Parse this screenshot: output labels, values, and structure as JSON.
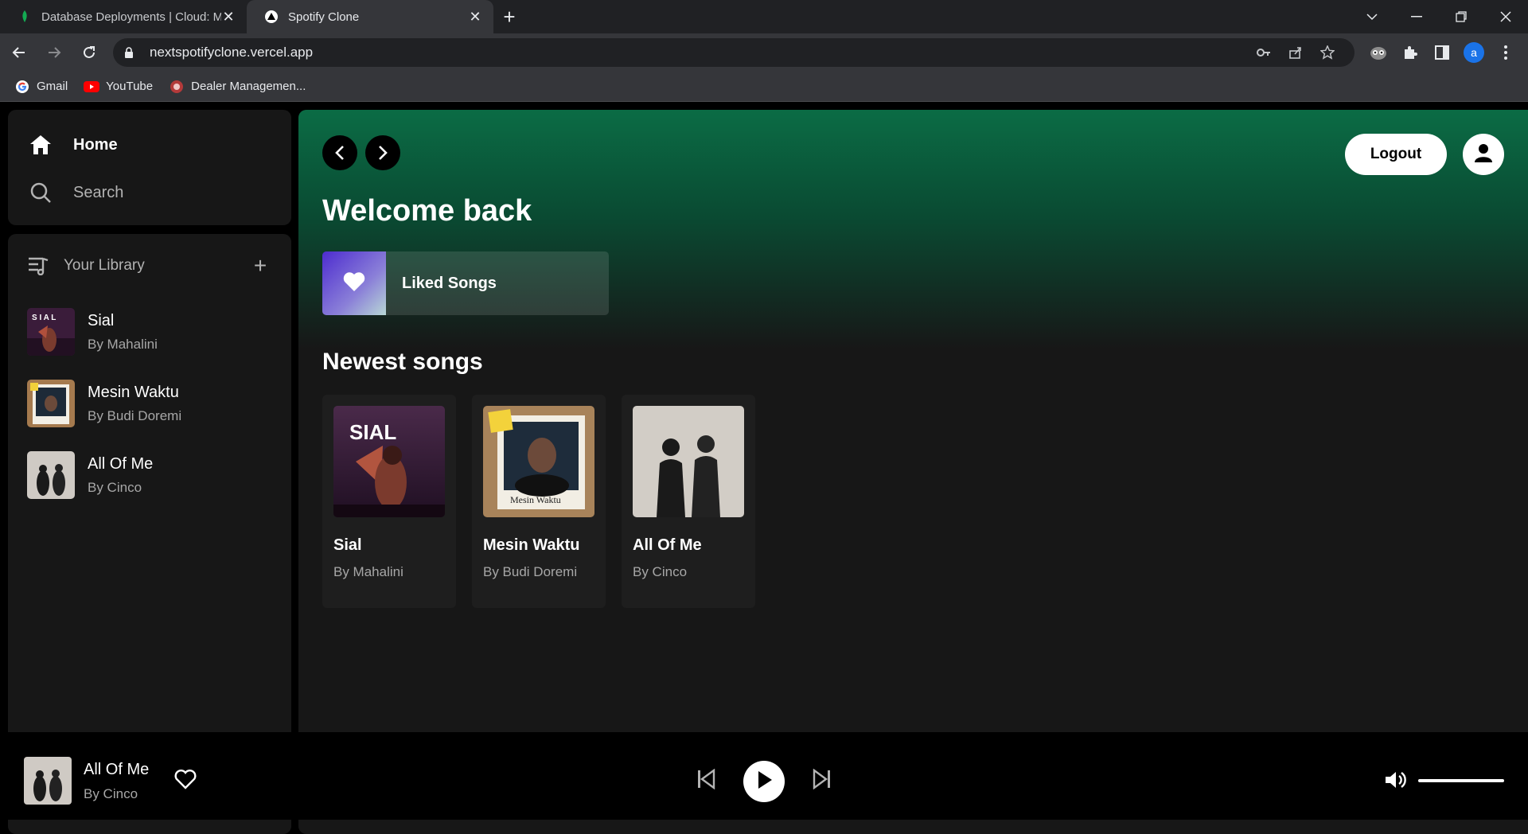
{
  "browser": {
    "tabs": [
      {
        "title": "Database Deployments | Cloud: M",
        "active": false
      },
      {
        "title": "Spotify Clone",
        "active": true
      }
    ],
    "url": "nextspotifyclone.vercel.app",
    "bookmarks": [
      {
        "label": "Gmail",
        "icon": "google-icon"
      },
      {
        "label": "YouTube",
        "icon": "youtube-icon"
      },
      {
        "label": "Dealer Managemen...",
        "icon": "dealer-icon"
      }
    ],
    "profile_initial": "a"
  },
  "sidebar": {
    "nav": [
      {
        "label": "Home",
        "icon": "home-icon"
      },
      {
        "label": "Search",
        "icon": "search-icon"
      }
    ],
    "library": {
      "label": "Your Library",
      "items": [
        {
          "title": "Sial",
          "artist": "By Mahalini"
        },
        {
          "title": "Mesin Waktu",
          "artist": "By Budi Doremi"
        },
        {
          "title": "All Of Me",
          "artist": "By Cinco"
        }
      ]
    }
  },
  "main": {
    "logout_label": "Logout",
    "welcome": "Welcome back",
    "liked_label": "Liked Songs",
    "newest_title": "Newest songs",
    "cards": [
      {
        "title": "Sial",
        "artist": "By Mahalini",
        "cover_text": "SIAL"
      },
      {
        "title": "Mesin Waktu",
        "artist": "By Budi Doremi",
        "cover_text": "Mesin Waktu"
      },
      {
        "title": "All Of Me",
        "artist": "By Cinco"
      }
    ]
  },
  "player": {
    "title": "All Of Me",
    "artist": "By Cinco",
    "volume": 1.0
  },
  "colors": {
    "accent_green": "#0b6c45",
    "panel": "#171717",
    "muted_text": "#a7a7a7"
  }
}
